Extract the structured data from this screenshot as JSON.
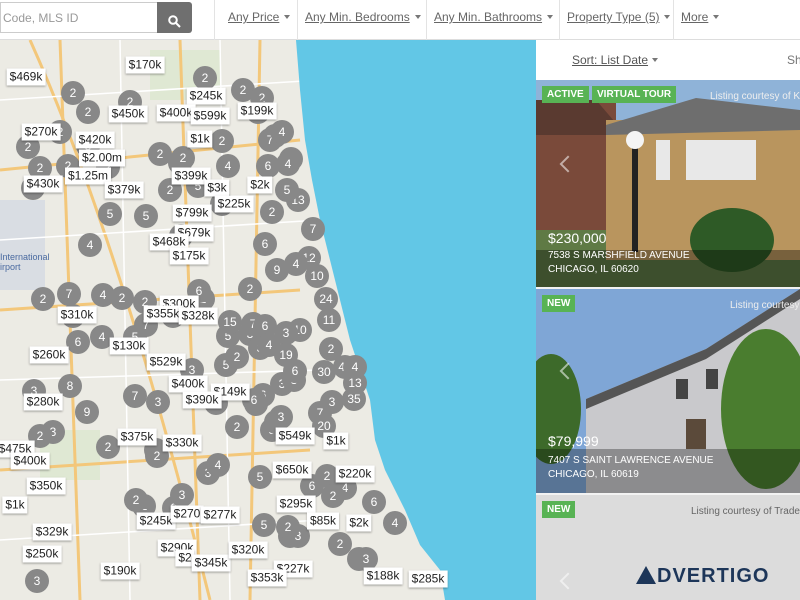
{
  "search": {
    "placeholder": "Code, MLS ID",
    "icon": "search-icon"
  },
  "filters": [
    "Any Price",
    "Any Min. Bedrooms",
    "Any Min. Bathrooms",
    "Property Type (5)",
    "More"
  ],
  "sort": {
    "label": "Sort: List Date",
    "show_label": "Sh"
  },
  "colors": {
    "water": "#62c7e6",
    "cluster": "#888888",
    "badge_green": "#58b354",
    "brand": "#1d3659"
  },
  "map": {
    "labels": [
      "International",
      "irport"
    ],
    "prices": [
      "$469k",
      "$170k",
      "$245k",
      "$199k",
      "$450k",
      "$400k",
      "$599k",
      "$270k",
      "$420k",
      "$1k",
      "$2.00m",
      "$1.25m",
      "$430k",
      "$399k",
      "$379k",
      "$3k",
      "$2k",
      "$225k",
      "$799k",
      "$679k",
      "$468k",
      "$175k",
      "$300k",
      "$310k",
      "$355k",
      "$328k",
      "$130k",
      "$260k",
      "$529k",
      "$400k",
      "$149k",
      "$390k",
      "$280k",
      "$375k",
      "$330k",
      "$549k",
      "$1k",
      "$475k",
      "$400k",
      "$650k",
      "$220k",
      "$350k",
      "$1k",
      "$245k",
      "$270",
      "$277k",
      "$295k",
      "$85k",
      "$2k",
      "$329k",
      "$250k",
      "$290k",
      "$2",
      "$345k",
      "$320k",
      "$227k",
      "$353k",
      "$190k",
      "$188k",
      "$285k"
    ],
    "clusters": [
      "2",
      "2",
      "2",
      "2",
      "2",
      "2",
      "2",
      "2",
      "3",
      "2",
      "2",
      "2",
      "2",
      "2",
      "3",
      "2",
      "4",
      "4",
      "2",
      "2",
      "2",
      "7",
      "4",
      "6",
      "5",
      "3",
      "4",
      "13",
      "5",
      "2",
      "2",
      "7",
      "5",
      "5",
      "4",
      "2",
      "6",
      "2",
      "7",
      "4",
      "9",
      "2",
      "12",
      "10",
      "4",
      "2",
      "2",
      "2",
      "7",
      "5",
      "5",
      "6",
      "24",
      "3",
      "10",
      "2",
      "5",
      "5",
      "4",
      "15",
      "7",
      "6",
      "3",
      "8",
      "6",
      "11",
      "2",
      "2",
      "3",
      "19",
      "4",
      "3",
      "3",
      "6",
      "6",
      "30",
      "46",
      "13",
      "4",
      "3",
      "3",
      "7",
      "7",
      "3",
      "3",
      "4",
      "20",
      "35",
      "5",
      "6",
      "8",
      "9",
      "3",
      "2",
      "2",
      "3",
      "2",
      "3",
      "4",
      "2",
      "3",
      "5",
      "2",
      "3",
      "4",
      "2",
      "3",
      "2",
      "4",
      "5",
      "3",
      "6",
      "3",
      "6",
      "2",
      "4",
      "2",
      "6",
      "3",
      "2",
      "3"
    ]
  },
  "listings": [
    {
      "badges": [
        "ACTIVE",
        "VIRTUAL TOUR"
      ],
      "courtesy": "Listing courtesy of K",
      "price": "$230,000",
      "address1": "7538 S MARSHFIELD AVENUE",
      "address2": "CHICAGO, IL 60620"
    },
    {
      "badges": [
        "NEW"
      ],
      "courtesy": "Listing courtesy",
      "price": "$79,999",
      "address1": "7407 S SAINT LAWRENCE AVENUE",
      "address2": "CHICAGO, IL 60619"
    },
    {
      "badges": [
        "NEW"
      ],
      "courtesy": "Listing courtesy of Trade"
    }
  ],
  "brand": {
    "logo_text": "DVERTIGO"
  }
}
